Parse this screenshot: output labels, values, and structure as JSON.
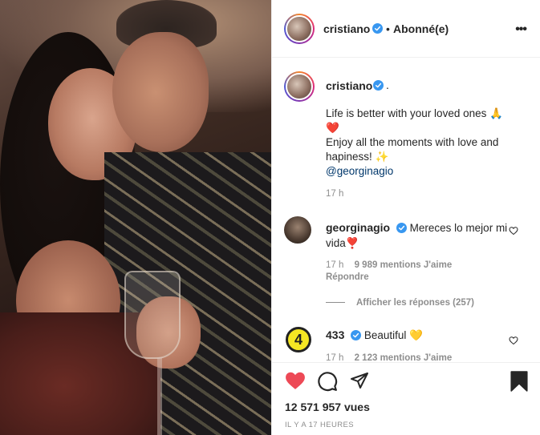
{
  "header": {
    "username": "cristiano",
    "dot": "•",
    "follow_status": "Abonné(e)",
    "more_label": "•••"
  },
  "caption": {
    "username": "cristiano",
    "suffix": ".",
    "line1": "Life is better with your loved ones 🙏",
    "line2": "❤️",
    "line3": "Enjoy all the moments with love and hapiness! ✨",
    "mention": "@georginagio",
    "time": "17 h"
  },
  "comments": [
    {
      "username": "georginagio",
      "text": "Mereces lo mejor mi vida❣️",
      "time": "17 h",
      "likes": "9 989 mentions J'aime",
      "reply_label": "Répondre",
      "view_replies": "Afficher les réponses (257)"
    },
    {
      "username": "433",
      "avatar_text": "4",
      "text": "Beautiful 💛",
      "time": "17 h",
      "likes": "2 123 mentions J'aime"
    }
  ],
  "actions": {
    "views": "12 571 957 vues",
    "timestamp": "IL Y A 17 HEURES",
    "liked": true
  },
  "colors": {
    "heart": "#ed4956",
    "verified": "#3897f0",
    "mention": "#00376b",
    "secondary_text": "#8e8e8e"
  }
}
